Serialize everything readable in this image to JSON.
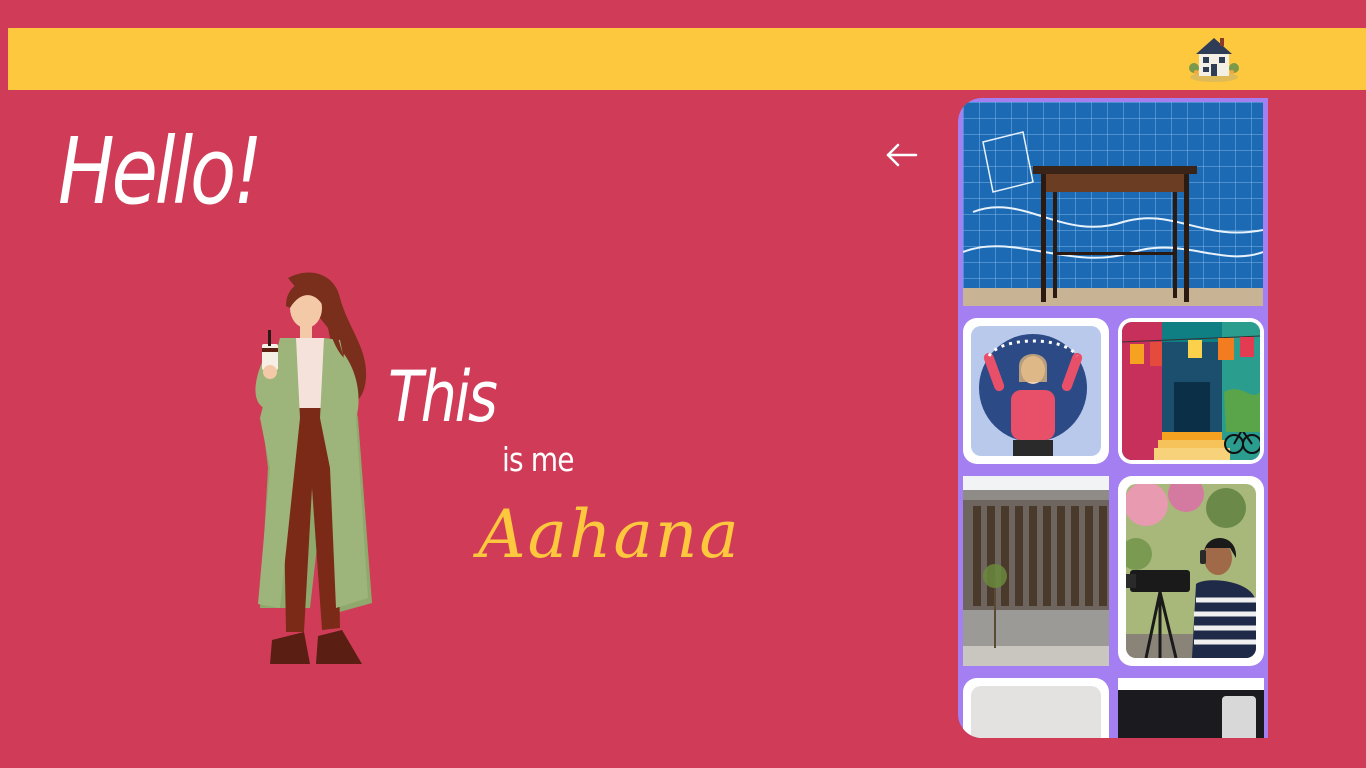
{
  "header": {
    "home_icon": "house-icon"
  },
  "hero": {
    "greeting": "Hello!",
    "line1": "This",
    "line2": "is me",
    "name": "Aahana"
  },
  "nav": {
    "back_icon": "arrow-left-icon"
  },
  "gallery": {
    "items": [
      {
        "subject": "desk against blue tile mural"
      },
      {
        "subject": "girl with flower garland illustration"
      },
      {
        "subject": "colorful street with hanging clothes illustration"
      },
      {
        "subject": "concrete building with wooden slats"
      },
      {
        "subject": "person filming with camera"
      },
      {
        "subject": "white paper"
      },
      {
        "subject": "dark photo"
      }
    ]
  },
  "colors": {
    "background": "#d03c58",
    "topbar": "#fdc73e",
    "gallery_frame": "#a47ff2",
    "name_text": "#fdc73e"
  }
}
